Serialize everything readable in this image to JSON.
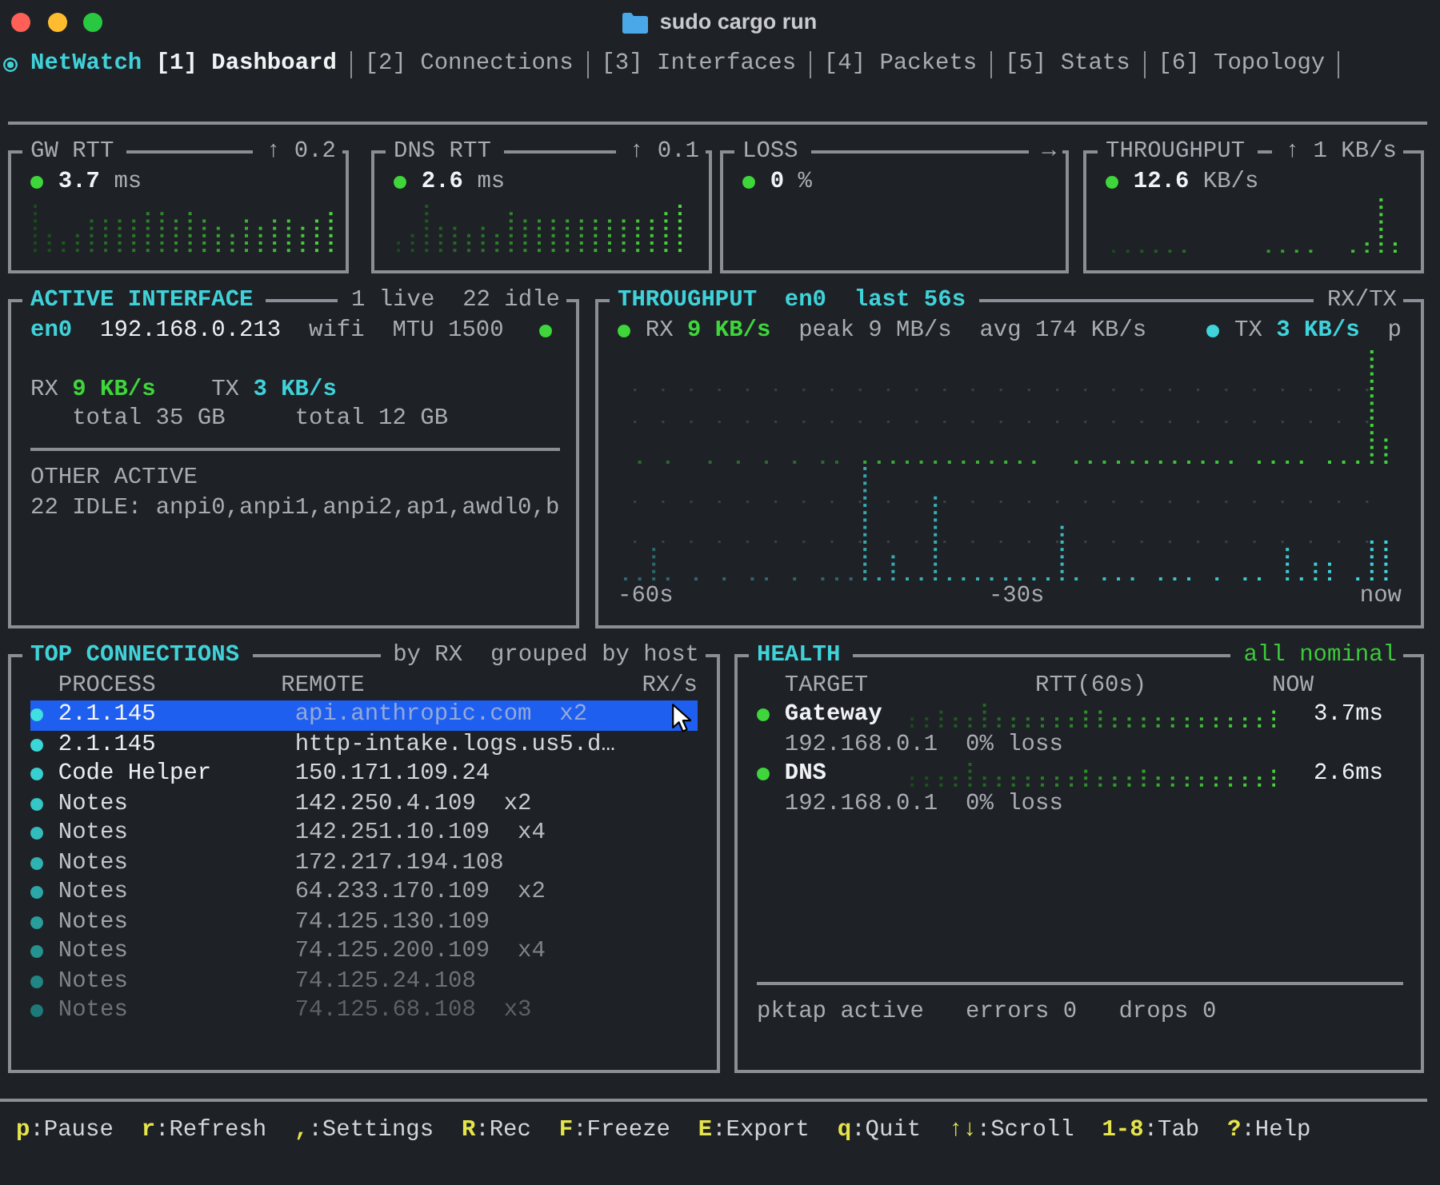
{
  "window": {
    "title": "sudo cargo run"
  },
  "app": {
    "name": "NetWatch"
  },
  "tabs": [
    {
      "label": "[1] Dashboard",
      "selected": true
    },
    {
      "label": "[2] Connections",
      "selected": false
    },
    {
      "label": "[3] Interfaces",
      "selected": false
    },
    {
      "label": "[4] Packets",
      "selected": false
    },
    {
      "label": "[5] Stats",
      "selected": false
    },
    {
      "label": "[6] Topology",
      "selected": false
    }
  ],
  "metric_panels": [
    {
      "title": "GW RTT",
      "trend": "↑ 0.2",
      "value": "3.7",
      "unit": "ms",
      "color": "#3ed63a"
    },
    {
      "title": "DNS RTT",
      "trend": "↑ 0.1",
      "value": "2.6",
      "unit": "ms",
      "color": "#3ed63a"
    },
    {
      "title": "LOSS",
      "trend": "→",
      "value": "0",
      "unit": "%",
      "color": "#3ed63a"
    },
    {
      "title": "THROUGHPUT",
      "trend": "↑ 1 KB/s",
      "value": "12.6",
      "unit": "KB/s",
      "color": "#3ed63a"
    }
  ],
  "active_interface": {
    "title": "ACTIVE INTERFACE",
    "counts": [
      "1 live",
      "22 idle"
    ],
    "name": "en0",
    "address": "192.168.0.213",
    "type": "wifi",
    "mtu": "MTU 1500",
    "status_dot": {
      "color": "#3ed63a"
    },
    "rx": {
      "label": "RX",
      "rate": "9 KB/s",
      "total": "total 35 GB"
    },
    "tx": {
      "label": "TX",
      "rate": "3 KB/s",
      "total": "total 12 GB"
    },
    "other_heading": "OTHER ACTIVE",
    "idle_list": "22 IDLE: anpi0,anpi1,anpi2,ap1,awdl0,b"
  },
  "throughput": {
    "title": "THROUGHPUT",
    "interface": "en0",
    "window": "last 56s",
    "mode": "RX/TX",
    "series": [
      {
        "label": "RX",
        "rate": "9 KB/s",
        "color": "#3ed63a",
        "stats": [
          "peak 9 MB/s",
          "avg 174 KB/s"
        ]
      },
      {
        "label": "TX",
        "rate": "3 KB/s",
        "color": "#3fd3dc",
        "stats": [
          "p"
        ]
      }
    ],
    "x_labels": [
      "-60s",
      "-30s",
      "now"
    ]
  },
  "connections": {
    "title": "TOP CONNECTIONS",
    "sort": "by RX",
    "grouping": "grouped by host",
    "columns": [
      "PROCESS",
      "REMOTE",
      "RX/s"
    ],
    "rows": [
      {
        "process": "2.1.145",
        "remote": "api.anthropic.com",
        "count": "x2",
        "selected": true,
        "color": "#40e0e2"
      },
      {
        "process": "2.1.145",
        "remote": "http-intake.logs.us5.d…",
        "selected": false,
        "color": "#3bd7d8"
      },
      {
        "process": "Code Helper",
        "remote": "150.171.109.24",
        "selected": false,
        "color": "#38cfd0"
      },
      {
        "process": "Notes",
        "remote": "142.250.4.109",
        "count": "x2",
        "selected": false,
        "color": "#35c6c6"
      },
      {
        "process": "Notes",
        "remote": "142.251.10.109",
        "count": "x4",
        "selected": false,
        "color": "#32bcbc"
      },
      {
        "process": "Notes",
        "remote": "172.217.194.108",
        "selected": false,
        "color": "#2fb2b2"
      },
      {
        "process": "Notes",
        "remote": "64.233.170.109",
        "count": "x2",
        "selected": false,
        "color": "#2ca7a7"
      },
      {
        "process": "Notes",
        "remote": "74.125.130.109",
        "selected": false,
        "color": "#299c9c"
      },
      {
        "process": "Notes",
        "remote": "74.125.200.109",
        "count": "x4",
        "selected": false,
        "color": "#269191"
      },
      {
        "process": "Notes",
        "remote": "74.125.24.108",
        "selected": false,
        "color": "#228585"
      },
      {
        "process": "Notes",
        "remote": "74.125.68.108",
        "count": "x3",
        "selected": false,
        "color": "#1e7a7a"
      }
    ]
  },
  "health": {
    "title": "HEALTH",
    "status": "all nominal",
    "columns": [
      "TARGET",
      "RTT(60s)",
      "NOW"
    ],
    "targets": [
      {
        "name": "Gateway",
        "address": "192.168.0.1",
        "loss": "0% loss",
        "now": "3.7ms",
        "color": "#3ed63a"
      },
      {
        "name": "DNS",
        "address": "192.168.0.1",
        "loss": "0% loss",
        "now": "2.6ms",
        "color": "#3ed63a"
      }
    ],
    "footer": [
      "pktap active",
      "errors 0",
      "drops 0"
    ]
  },
  "shortcuts": [
    {
      "key": "p",
      "action": ":Pause"
    },
    {
      "key": "r",
      "action": ":Refresh"
    },
    {
      "key": ",",
      "action": ":Settings"
    },
    {
      "key": "R",
      "action": ":Rec"
    },
    {
      "key": "F",
      "action": ":Freeze"
    },
    {
      "key": "E",
      "action": ":Export"
    },
    {
      "key": "q",
      "action": ":Quit"
    },
    {
      "key": "↑↓",
      "action": ":Scroll"
    },
    {
      "key": "1-8",
      "action": ":Tab"
    },
    {
      "key": "?",
      "action": ":Help"
    }
  ]
}
